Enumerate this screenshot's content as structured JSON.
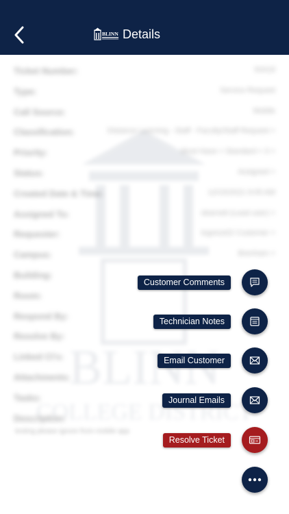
{
  "header": {
    "title": "Details",
    "logo_text": "BLINN"
  },
  "details": [
    {
      "label": "Ticket Number:",
      "value": "93418"
    },
    {
      "label": "Type:",
      "value": "Service Request"
    },
    {
      "label": "Call Source:",
      "value": "Mobile"
    },
    {
      "label": "Classification:",
      "value": "Distance Learning - Staff - Faculty/Staff Request >"
    },
    {
      "label": "Priority:",
      "value": "Must Have < Standard < 3 >"
    },
    {
      "label": "Status:",
      "value": "Assigned >"
    },
    {
      "label": "Created Date & Time:",
      "value": "12/15/2021 9:05 AM"
    },
    {
      "label": "Assigned To:",
      "value": "sbarnett (Lead user) >"
    },
    {
      "label": "Requester:",
      "value": "togress02 Customer >"
    },
    {
      "label": "Campus:",
      "value": "Brenham >"
    },
    {
      "label": "Building:",
      "value": ""
    },
    {
      "label": "Room:",
      "value": ""
    },
    {
      "label": "Respond By:",
      "value": ""
    },
    {
      "label": "Resolve By:",
      "value": ""
    },
    {
      "label": "Linked CI's:",
      "value": ""
    },
    {
      "label": "Attachments:",
      "value": ""
    },
    {
      "label": "Tasks:",
      "value": ""
    },
    {
      "label": "Description:",
      "value": ""
    }
  ],
  "description_text": "testing please ignore from mobile app",
  "watermark": {
    "line1": "BLINN",
    "line2": "COLLEGE DISTRICT"
  },
  "fab_menu": [
    {
      "label": "Customer Comments",
      "icon": "comment-icon"
    },
    {
      "label": "Technician Notes",
      "icon": "notes-icon"
    },
    {
      "label": "Email Customer",
      "icon": "mail-icon"
    },
    {
      "label": "Journal Emails",
      "icon": "mail-icon"
    },
    {
      "label": "Resolve Ticket",
      "icon": "resolve-icon"
    }
  ],
  "colors": {
    "navy": "#0e2347",
    "danger": "#a51c1f"
  }
}
